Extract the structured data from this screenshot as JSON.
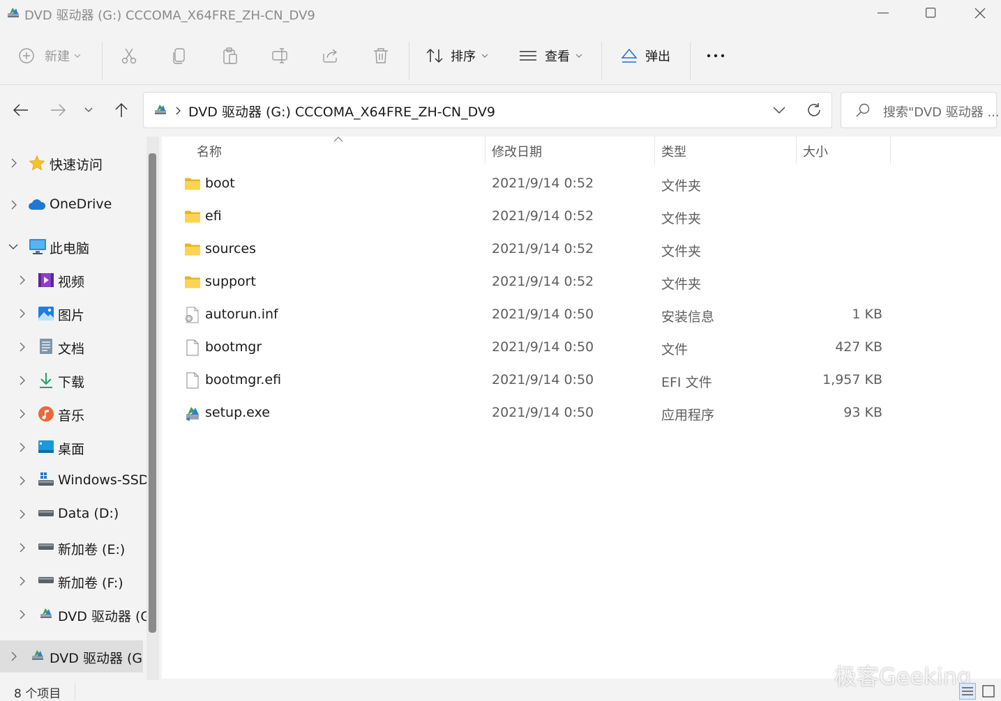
{
  "window": {
    "title": "DVD 驱动器 (G:) CCCOMA_X64FRE_ZH-CN_DV9"
  },
  "toolbar": {
    "new_label": "新建",
    "sort_label": "排序",
    "view_label": "查看",
    "eject_label": "弹出",
    "more_label": "···"
  },
  "address": {
    "path": "DVD 驱动器 (G:) CCCOMA_X64FRE_ZH-CN_DV9",
    "search_placeholder": "搜索\"DVD 驱动器 ..."
  },
  "nav": {
    "items": [
      {
        "label": "快速访问"
      },
      {
        "label": "OneDrive"
      },
      {
        "label": "此电脑"
      },
      {
        "label": "视频"
      },
      {
        "label": "图片"
      },
      {
        "label": "文档"
      },
      {
        "label": "下载"
      },
      {
        "label": "音乐"
      },
      {
        "label": "桌面"
      },
      {
        "label": "Windows-SSD"
      },
      {
        "label": "Data (D:)"
      },
      {
        "label": "新加卷 (E:)"
      },
      {
        "label": "新加卷 (F:)"
      },
      {
        "label": "DVD 驱动器 (G"
      },
      {
        "label": "DVD 驱动器 (G:)"
      }
    ]
  },
  "columns": {
    "name": "名称",
    "modified": "修改日期",
    "type": "类型",
    "size": "大小"
  },
  "files": [
    {
      "name": "boot",
      "modified": "2021/9/14 0:52",
      "type": "文件夹",
      "size": ""
    },
    {
      "name": "efi",
      "modified": "2021/9/14 0:52",
      "type": "文件夹",
      "size": ""
    },
    {
      "name": "sources",
      "modified": "2021/9/14 0:52",
      "type": "文件夹",
      "size": ""
    },
    {
      "name": "support",
      "modified": "2021/9/14 0:52",
      "type": "文件夹",
      "size": ""
    },
    {
      "name": "autorun.inf",
      "modified": "2021/9/14 0:50",
      "type": "安装信息",
      "size": "1 KB"
    },
    {
      "name": "bootmgr",
      "modified": "2021/9/14 0:50",
      "type": "文件",
      "size": "427 KB"
    },
    {
      "name": "bootmgr.efi",
      "modified": "2021/9/14 0:50",
      "type": "EFI 文件",
      "size": "1,957 KB"
    },
    {
      "name": "setup.exe",
      "modified": "2021/9/14 0:50",
      "type": "应用程序",
      "size": "93 KB"
    }
  ],
  "status": {
    "count": "8 个项目"
  },
  "watermark": "极客Geeking"
}
